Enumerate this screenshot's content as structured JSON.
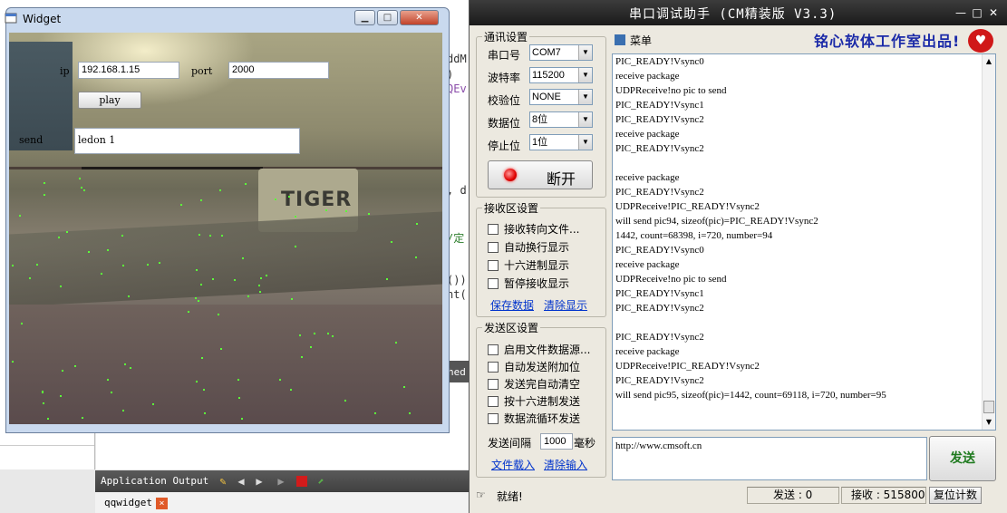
{
  "ide": {
    "code_fragments": [
      "ddM",
      ")",
      "QEv",
      ", d",
      "/定",
      "())",
      "nt(",
      "hed"
    ],
    "output_label": "Application Output",
    "tab_label": "qqwidget",
    "tab_close": "×"
  },
  "widget": {
    "title": "Widget",
    "minimize": "▁",
    "maximize": "□",
    "close": "✕",
    "ip_label": "ip",
    "ip_value": "192.168.1.15",
    "port_label": "port",
    "port_value": "2000",
    "play_label": "play",
    "send_label": "send",
    "send_value": "ledon 1",
    "video_text": "TIGER"
  },
  "serial": {
    "title": "串口调试助手 (CM精装版 V3.3)",
    "min": "—",
    "max": "□",
    "close": "✕",
    "menu": "菜单",
    "brand": "铭心软体工作室出品!",
    "comm_group": "通讯设置",
    "port_label": "串口号",
    "port_value": "COM7",
    "baud_label": "波特率",
    "baud_value": "115200",
    "parity_label": "校验位",
    "parity_value": "NONE",
    "databits_label": "数据位",
    "databits_value": "8位",
    "stopbits_label": "停止位",
    "stopbits_value": "1位",
    "open_button": "断开",
    "recv_group": "接收区设置",
    "recv_opts": [
      "接收转向文件...",
      "自动换行显示",
      "十六进制显示",
      "暂停接收显示"
    ],
    "save_data": "保存数据",
    "clear_display": "清除显示",
    "send_group": "发送区设置",
    "send_opts": [
      "启用文件数据源...",
      "自动发送附加位",
      "发送完自动清空",
      "按十六进制发送",
      "数据流循环发送"
    ],
    "interval_label": "发送间隔",
    "interval_value": "1000",
    "interval_unit": "毫秒",
    "file_load": "文件载入",
    "clear_input": "清除输入",
    "recv_lines": [
      "PIC_READY!Vsync0",
      "receive package",
      "UDPReceive!no pic to send",
      "PIC_READY!Vsync1",
      "PIC_READY!Vsync2",
      "receive package",
      "PIC_READY!Vsync2",
      "",
      "receive package",
      "PIC_READY!Vsync2",
      "UDPReceive!PIC_READY!Vsync2",
      "will send pic94, sizeof(pic)=PIC_READY!Vsync2",
      "1442, count=68398, i=720, number=94",
      "PIC_READY!Vsync0",
      "receive package",
      "UDPReceive!no pic to send",
      "PIC_READY!Vsync1",
      "PIC_READY!Vsync2",
      "",
      "PIC_READY!Vsync2",
      "receive package",
      "UDPReceive!PIC_READY!Vsync2",
      "PIC_READY!Vsync2",
      "will send pic95, sizeof(pic)=1442, count=69118, i=720, number=95"
    ],
    "send_text": "http://www.cmsoft.cn",
    "send_button": "发送",
    "status_ready": "就绪!",
    "status_sent": "发送 : 0",
    "status_recv": "接收 : 515800",
    "reset_count": "复位计数"
  }
}
